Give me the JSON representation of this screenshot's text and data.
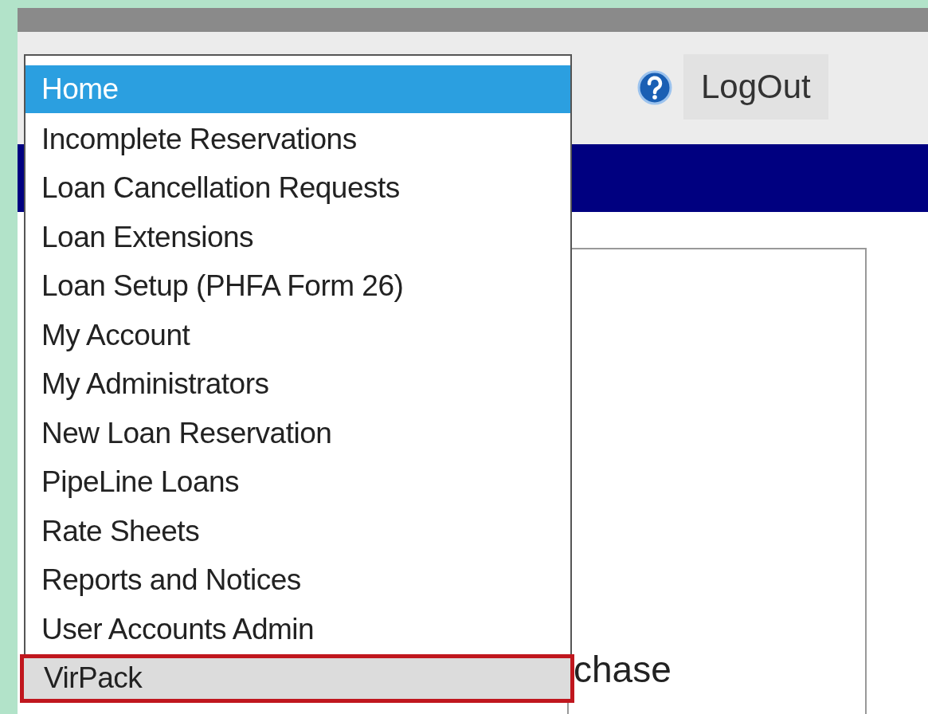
{
  "toolbar": {
    "logout_button": "LogOut"
  },
  "menu": {
    "items": [
      {
        "label": "Home",
        "selected": true,
        "hovered": false,
        "outlined": false
      },
      {
        "label": "Incomplete Reservations",
        "selected": false,
        "hovered": false,
        "outlined": false
      },
      {
        "label": "Loan Cancellation Requests",
        "selected": false,
        "hovered": false,
        "outlined": false
      },
      {
        "label": "Loan Extensions",
        "selected": false,
        "hovered": false,
        "outlined": false
      },
      {
        "label": "Loan Setup (PHFA Form 26)",
        "selected": false,
        "hovered": false,
        "outlined": false
      },
      {
        "label": "My Account",
        "selected": false,
        "hovered": false,
        "outlined": false
      },
      {
        "label": "My Administrators",
        "selected": false,
        "hovered": false,
        "outlined": false
      },
      {
        "label": "New Loan Reservation",
        "selected": false,
        "hovered": false,
        "outlined": false
      },
      {
        "label": "PipeLine Loans",
        "selected": false,
        "hovered": false,
        "outlined": false
      },
      {
        "label": "Rate Sheets",
        "selected": false,
        "hovered": false,
        "outlined": false
      },
      {
        "label": "Reports and Notices",
        "selected": false,
        "hovered": false,
        "outlined": false
      },
      {
        "label": "User Accounts Admin",
        "selected": false,
        "hovered": false,
        "outlined": false
      },
      {
        "label": "VirPack",
        "selected": false,
        "hovered": true,
        "outlined": true
      }
    ]
  },
  "panel": {
    "text": "chase"
  }
}
